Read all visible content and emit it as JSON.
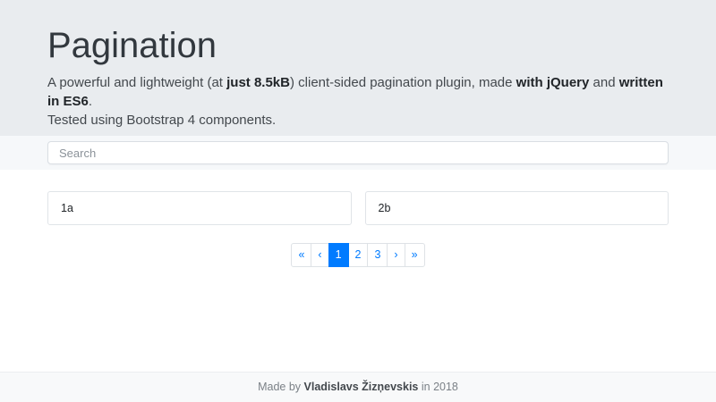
{
  "jumbotron": {
    "title": "Pagination",
    "line1_parts": [
      "A powerful and lightweight (at ",
      "just 8.5kB",
      ") client-sided pagination plugin, made ",
      "with jQuery",
      " and ",
      "written in ES6",
      "."
    ],
    "line2": "Tested using Bootstrap 4 components.",
    "bg_color": "#e9ecef"
  },
  "search": {
    "placeholder": "Search",
    "value": "",
    "band_bg_color": "#f6f8fa"
  },
  "cards": [
    {
      "label": "1a"
    },
    {
      "label": "2b"
    }
  ],
  "pagination": {
    "items": [
      {
        "label": "«",
        "name": "first"
      },
      {
        "label": "‹",
        "name": "prev"
      },
      {
        "label": "1",
        "name": "page-1",
        "active": true
      },
      {
        "label": "2",
        "name": "page-2"
      },
      {
        "label": "3",
        "name": "page-3"
      },
      {
        "label": "›",
        "name": "next"
      },
      {
        "label": "»",
        "name": "last"
      }
    ],
    "active_page": "1",
    "active_bg_color": "#007bff",
    "link_color": "#007bff",
    "border_color": "#dee2e6"
  },
  "footer": {
    "prefix": "Made by ",
    "author": "Vladislavs Žizņevskis",
    "suffix": " in 2018",
    "bg_color": "#f8f9fa"
  }
}
